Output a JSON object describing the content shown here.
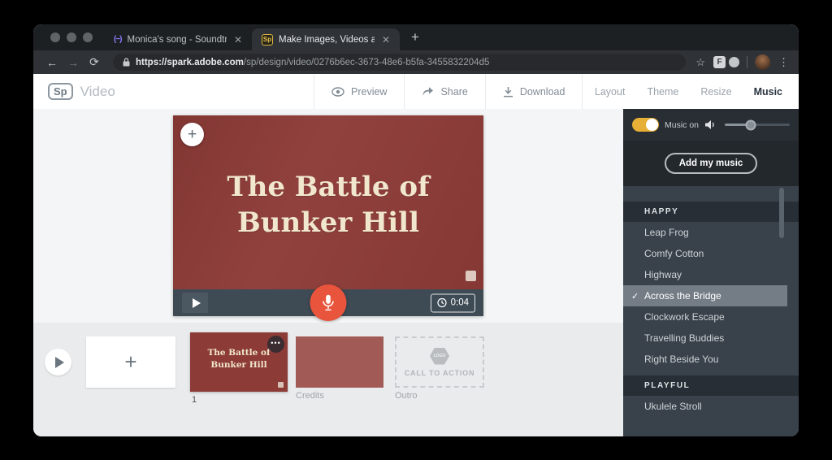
{
  "colors": {
    "accent_gold": "#E7AF35",
    "slide_maroon": "#8D3B37",
    "mic_orange": "#E8543C",
    "title_cream": "#F1E7CE",
    "sidebar_dark": "#343D46"
  },
  "browser": {
    "tabs": [
      {
        "title": "Monica's song - Soundtrap"
      },
      {
        "title": "Make Images, Videos and Web"
      }
    ],
    "new_tab_symbol": "+",
    "url_host": "https://spark.adobe.com",
    "url_path": "/sp/design/video/0276b6ec-3673-48e6-b5fa-3455832204d5"
  },
  "app_header": {
    "logo_text": "Sp",
    "app_name": "Video",
    "preview_label": "Preview",
    "share_label": "Share",
    "download_label": "Download",
    "nav": [
      {
        "label": "Layout"
      },
      {
        "label": "Theme"
      },
      {
        "label": "Resize"
      },
      {
        "label": "Music"
      }
    ]
  },
  "video": {
    "title": "The Battle of\nBunker Hill",
    "add_symbol": "+",
    "duration": "0:04"
  },
  "timeline": {
    "add_slide_symbol": "+",
    "slide1_title": "The Battle of\nBunker Hill",
    "slide1_label": "1",
    "slide1_menu": "•••",
    "credits_label": "Credits",
    "outro_label": "Outro",
    "outro_badge": "LOGO",
    "outro_cta": "CALL TO ACTION"
  },
  "sidebar": {
    "music_on_label": "Music on",
    "add_music_label": "Add my music",
    "sections": [
      {
        "header": "HAPPY",
        "selected": "Across the Bridge",
        "tracks": [
          "Leap Frog",
          "Comfy Cotton",
          "Highway",
          "Across the Bridge",
          "Clockwork Escape",
          "Travelling Buddies",
          "Right Beside You"
        ]
      },
      {
        "header": "PLAYFUL",
        "selected": null,
        "tracks": [
          "Ukulele Stroll"
        ]
      }
    ]
  }
}
